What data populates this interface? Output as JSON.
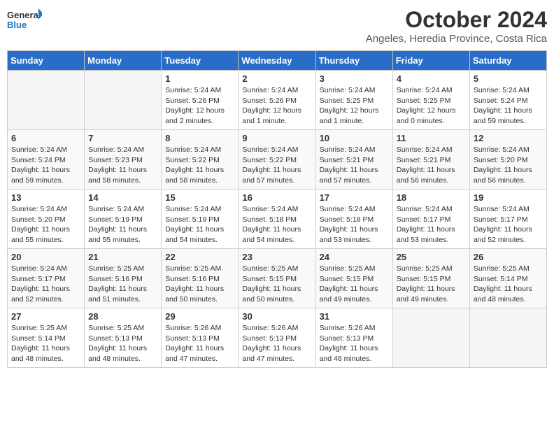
{
  "header": {
    "logo_text_general": "General",
    "logo_text_blue": "Blue",
    "month_title": "October 2024",
    "location": "Angeles, Heredia Province, Costa Rica"
  },
  "days_of_week": [
    "Sunday",
    "Monday",
    "Tuesday",
    "Wednesday",
    "Thursday",
    "Friday",
    "Saturday"
  ],
  "weeks": [
    [
      {
        "day": "",
        "empty": true
      },
      {
        "day": "",
        "empty": true
      },
      {
        "day": "1",
        "sunrise": "Sunrise: 5:24 AM",
        "sunset": "Sunset: 5:26 PM",
        "daylight": "Daylight: 12 hours and 2 minutes."
      },
      {
        "day": "2",
        "sunrise": "Sunrise: 5:24 AM",
        "sunset": "Sunset: 5:26 PM",
        "daylight": "Daylight: 12 hours and 1 minute."
      },
      {
        "day": "3",
        "sunrise": "Sunrise: 5:24 AM",
        "sunset": "Sunset: 5:25 PM",
        "daylight": "Daylight: 12 hours and 1 minute."
      },
      {
        "day": "4",
        "sunrise": "Sunrise: 5:24 AM",
        "sunset": "Sunset: 5:25 PM",
        "daylight": "Daylight: 12 hours and 0 minutes."
      },
      {
        "day": "5",
        "sunrise": "Sunrise: 5:24 AM",
        "sunset": "Sunset: 5:24 PM",
        "daylight": "Daylight: 11 hours and 59 minutes."
      }
    ],
    [
      {
        "day": "6",
        "sunrise": "Sunrise: 5:24 AM",
        "sunset": "Sunset: 5:24 PM",
        "daylight": "Daylight: 11 hours and 59 minutes."
      },
      {
        "day": "7",
        "sunrise": "Sunrise: 5:24 AM",
        "sunset": "Sunset: 5:23 PM",
        "daylight": "Daylight: 11 hours and 58 minutes."
      },
      {
        "day": "8",
        "sunrise": "Sunrise: 5:24 AM",
        "sunset": "Sunset: 5:22 PM",
        "daylight": "Daylight: 11 hours and 58 minutes."
      },
      {
        "day": "9",
        "sunrise": "Sunrise: 5:24 AM",
        "sunset": "Sunset: 5:22 PM",
        "daylight": "Daylight: 11 hours and 57 minutes."
      },
      {
        "day": "10",
        "sunrise": "Sunrise: 5:24 AM",
        "sunset": "Sunset: 5:21 PM",
        "daylight": "Daylight: 11 hours and 57 minutes."
      },
      {
        "day": "11",
        "sunrise": "Sunrise: 5:24 AM",
        "sunset": "Sunset: 5:21 PM",
        "daylight": "Daylight: 11 hours and 56 minutes."
      },
      {
        "day": "12",
        "sunrise": "Sunrise: 5:24 AM",
        "sunset": "Sunset: 5:20 PM",
        "daylight": "Daylight: 11 hours and 56 minutes."
      }
    ],
    [
      {
        "day": "13",
        "sunrise": "Sunrise: 5:24 AM",
        "sunset": "Sunset: 5:20 PM",
        "daylight": "Daylight: 11 hours and 55 minutes."
      },
      {
        "day": "14",
        "sunrise": "Sunrise: 5:24 AM",
        "sunset": "Sunset: 5:19 PM",
        "daylight": "Daylight: 11 hours and 55 minutes."
      },
      {
        "day": "15",
        "sunrise": "Sunrise: 5:24 AM",
        "sunset": "Sunset: 5:19 PM",
        "daylight": "Daylight: 11 hours and 54 minutes."
      },
      {
        "day": "16",
        "sunrise": "Sunrise: 5:24 AM",
        "sunset": "Sunset: 5:18 PM",
        "daylight": "Daylight: 11 hours and 54 minutes."
      },
      {
        "day": "17",
        "sunrise": "Sunrise: 5:24 AM",
        "sunset": "Sunset: 5:18 PM",
        "daylight": "Daylight: 11 hours and 53 minutes."
      },
      {
        "day": "18",
        "sunrise": "Sunrise: 5:24 AM",
        "sunset": "Sunset: 5:17 PM",
        "daylight": "Daylight: 11 hours and 53 minutes."
      },
      {
        "day": "19",
        "sunrise": "Sunrise: 5:24 AM",
        "sunset": "Sunset: 5:17 PM",
        "daylight": "Daylight: 11 hours and 52 minutes."
      }
    ],
    [
      {
        "day": "20",
        "sunrise": "Sunrise: 5:24 AM",
        "sunset": "Sunset: 5:17 PM",
        "daylight": "Daylight: 11 hours and 52 minutes."
      },
      {
        "day": "21",
        "sunrise": "Sunrise: 5:25 AM",
        "sunset": "Sunset: 5:16 PM",
        "daylight": "Daylight: 11 hours and 51 minutes."
      },
      {
        "day": "22",
        "sunrise": "Sunrise: 5:25 AM",
        "sunset": "Sunset: 5:16 PM",
        "daylight": "Daylight: 11 hours and 50 minutes."
      },
      {
        "day": "23",
        "sunrise": "Sunrise: 5:25 AM",
        "sunset": "Sunset: 5:15 PM",
        "daylight": "Daylight: 11 hours and 50 minutes."
      },
      {
        "day": "24",
        "sunrise": "Sunrise: 5:25 AM",
        "sunset": "Sunset: 5:15 PM",
        "daylight": "Daylight: 11 hours and 49 minutes."
      },
      {
        "day": "25",
        "sunrise": "Sunrise: 5:25 AM",
        "sunset": "Sunset: 5:15 PM",
        "daylight": "Daylight: 11 hours and 49 minutes."
      },
      {
        "day": "26",
        "sunrise": "Sunrise: 5:25 AM",
        "sunset": "Sunset: 5:14 PM",
        "daylight": "Daylight: 11 hours and 48 minutes."
      }
    ],
    [
      {
        "day": "27",
        "sunrise": "Sunrise: 5:25 AM",
        "sunset": "Sunset: 5:14 PM",
        "daylight": "Daylight: 11 hours and 48 minutes."
      },
      {
        "day": "28",
        "sunrise": "Sunrise: 5:25 AM",
        "sunset": "Sunset: 5:13 PM",
        "daylight": "Daylight: 11 hours and 48 minutes."
      },
      {
        "day": "29",
        "sunrise": "Sunrise: 5:26 AM",
        "sunset": "Sunset: 5:13 PM",
        "daylight": "Daylight: 11 hours and 47 minutes."
      },
      {
        "day": "30",
        "sunrise": "Sunrise: 5:26 AM",
        "sunset": "Sunset: 5:13 PM",
        "daylight": "Daylight: 11 hours and 47 minutes."
      },
      {
        "day": "31",
        "sunrise": "Sunrise: 5:26 AM",
        "sunset": "Sunset: 5:13 PM",
        "daylight": "Daylight: 11 hours and 46 minutes."
      },
      {
        "day": "",
        "empty": true
      },
      {
        "day": "",
        "empty": true
      }
    ]
  ]
}
